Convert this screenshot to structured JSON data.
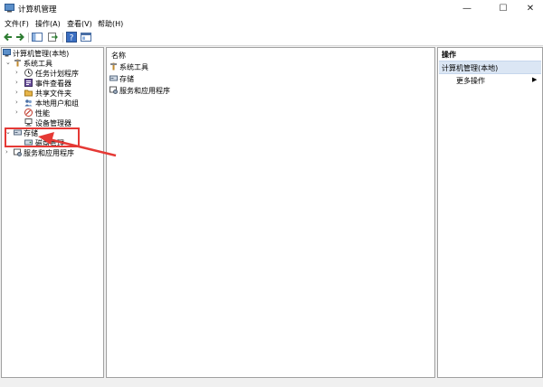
{
  "window": {
    "title": "计算机管理",
    "minimize": "—",
    "maximize": "☐",
    "close": "✕"
  },
  "menu": {
    "items": [
      "文件(F)",
      "操作(A)",
      "查看(V)",
      "帮助(H)"
    ]
  },
  "toolbar": {
    "icons": [
      "back-icon",
      "forward-icon",
      "show-hide-tree-icon",
      "export-list-icon",
      "help-icon",
      "properties-icon"
    ]
  },
  "tree": {
    "root": "计算机管理(本地)",
    "system_tools": "系统工具",
    "task_scheduler": "任务计划程序",
    "event_viewer": "事件查看器",
    "shared_folders": "共享文件夹",
    "local_users": "本地用户和组",
    "performance": "性能",
    "device_manager": "设备管理器",
    "storage": "存储",
    "disk_management": "磁盘管理",
    "services": "服务和应用程序"
  },
  "middle": {
    "column_header": "名称",
    "items": [
      "系统工具",
      "存储",
      "服务和应用程序"
    ]
  },
  "actions": {
    "title": "操作",
    "group": "计算机管理(本地)",
    "more": "更多操作",
    "more_arrow": "▶"
  },
  "colors": {
    "annotation": "#e53935",
    "selection": "#cce4f7",
    "actions_group": "#dbe6f4"
  }
}
